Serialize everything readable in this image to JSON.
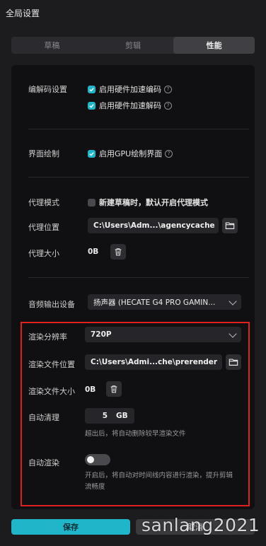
{
  "window": {
    "title": "全局设置"
  },
  "tabs": [
    {
      "label": "草稿",
      "active": false
    },
    {
      "label": "剪辑",
      "active": false
    },
    {
      "label": "性能",
      "active": true
    }
  ],
  "codec": {
    "label": "编解码设置",
    "options": [
      {
        "label": "启用硬件加速编码",
        "checked": true
      },
      {
        "label": "启用硬件加速解码",
        "checked": true
      }
    ]
  },
  "render_ui": {
    "label": "界面绘制",
    "option": {
      "label": "启用GPU绘制界面",
      "checked": true
    }
  },
  "proxy": {
    "mode_label": "代理模式",
    "mode_option": {
      "label": "新建草稿时，默认开启代理模式",
      "checked": false
    },
    "location_label": "代理位置",
    "location_value": "C:\\Users\\Adm...\\agencycache",
    "size_label": "代理大小",
    "size_value": "0B"
  },
  "audio": {
    "label": "音频输出设备",
    "device": "扬声器 (HECATE G4 PRO GAMIN..."
  },
  "render": {
    "resolution_label": "渲染分辨率",
    "resolution_value": "720P",
    "location_label": "渲染文件位置",
    "location_value": "C:\\Users\\Admi...che\\prerender",
    "size_label": "渲染文件大小",
    "size_value": "0B",
    "autoclean_label": "自动清理",
    "autoclean_value": "5",
    "autoclean_unit": "GB",
    "autoclean_hint": "超出后，将自动删除较早渲染文件",
    "autorender_label": "自动渲染",
    "autorender_on": false,
    "autorender_hint_line1": "开启后，将自动对时间线内容进行渲染，提升剪辑",
    "autorender_hint_line2": "流畅度"
  },
  "footer": {
    "save_label": "保存",
    "cancel_label": "取消"
  },
  "watermark": "sanlang2021",
  "colors": {
    "accent": "#1fb6c9",
    "highlight_border": "#e02020",
    "panel_bg": "#101012",
    "window_bg": "#1c1c1f"
  }
}
